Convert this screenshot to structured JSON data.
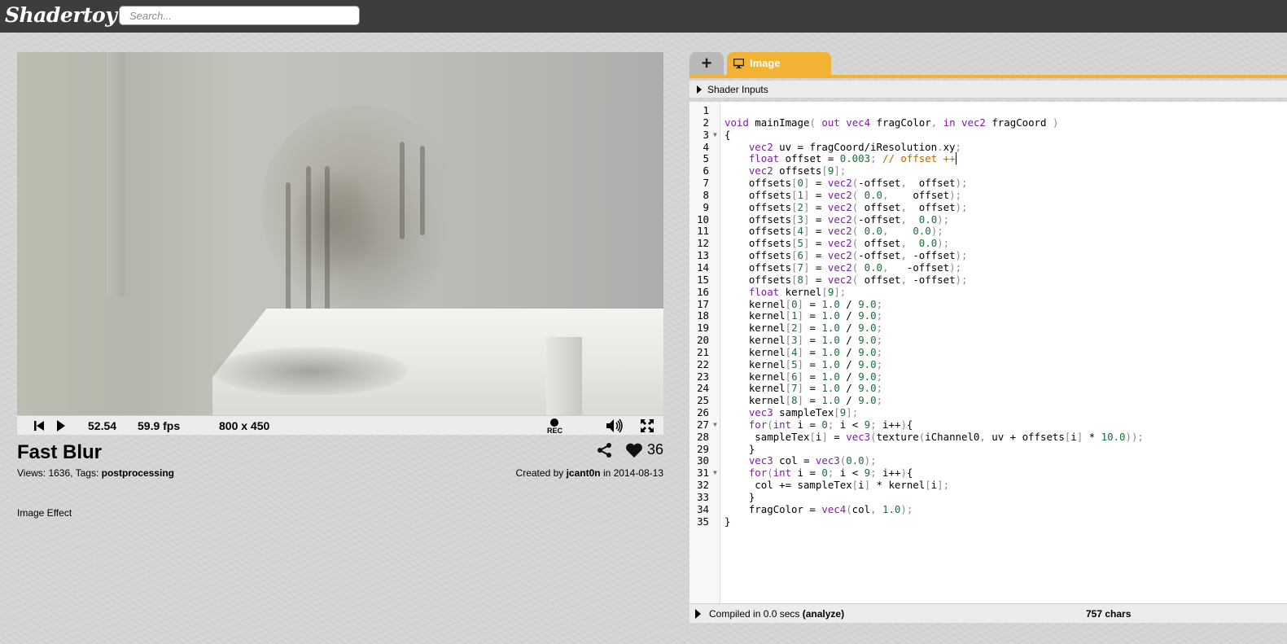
{
  "header": {
    "logo": "Shadertoy",
    "search_placeholder": "Search..."
  },
  "player": {
    "time": "52.54",
    "fps": "59.9 fps",
    "resolution": "800 x 450",
    "rec_label": "REC"
  },
  "shader": {
    "title": "Fast Blur",
    "views_label": "Views: 1636, Tags: ",
    "tag": "postprocessing",
    "likes": "36",
    "created_by_label": "Created by ",
    "author": "jcant0n",
    "date_label": " in 2014-08-13",
    "description": "Image Effect"
  },
  "editor": {
    "tab_add": "+",
    "tab_image": "Image",
    "inputs_label": "Shader Inputs",
    "compiled_label": "Compiled in 0.0 secs ",
    "analyze": "(analyze)",
    "chars": "757 chars",
    "accent_color": "#f2b233",
    "lines": [
      "",
      "void mainImage( out vec4 fragColor, in vec2 fragCoord )",
      "{",
      "    vec2 uv = fragCoord/iResolution.xy;",
      "    float offset = 0.003; // offset ++",
      "    vec2 offsets[9];",
      "    offsets[0] = vec2(-offset,  offset);",
      "    offsets[1] = vec2( 0.0,    offset);",
      "    offsets[2] = vec2( offset,  offset);",
      "    offsets[3] = vec2(-offset,  0.0);",
      "    offsets[4] = vec2( 0.0,    0.0);",
      "    offsets[5] = vec2( offset,  0.0);",
      "    offsets[6] = vec2(-offset, -offset);",
      "    offsets[7] = vec2( 0.0,   -offset);",
      "    offsets[8] = vec2( offset, -offset);",
      "    float kernel[9];",
      "    kernel[0] = 1.0 / 9.0;",
      "    kernel[1] = 1.0 / 9.0;",
      "    kernel[2] = 1.0 / 9.0;",
      "    kernel[3] = 1.0 / 9.0;",
      "    kernel[4] = 1.0 / 9.0;",
      "    kernel[5] = 1.0 / 9.0;",
      "    kernel[6] = 1.0 / 9.0;",
      "    kernel[7] = 1.0 / 9.0;",
      "    kernel[8] = 1.0 / 9.0;",
      "    vec3 sampleTex[9];",
      "    for(int i = 0; i < 9; i++){",
      "     sampleTex[i] = vec3(texture(iChannel0, uv + offsets[i] * 10.0));",
      "    }",
      "    vec3 col = vec3(0.0);",
      "    for(int i = 0; i < 9; i++){",
      "     col += sampleTex[i] * kernel[i];",
      "    }",
      "    fragColor = vec4(col, 1.0);",
      "}"
    ],
    "fold_lines": [
      3,
      27,
      31
    ]
  }
}
